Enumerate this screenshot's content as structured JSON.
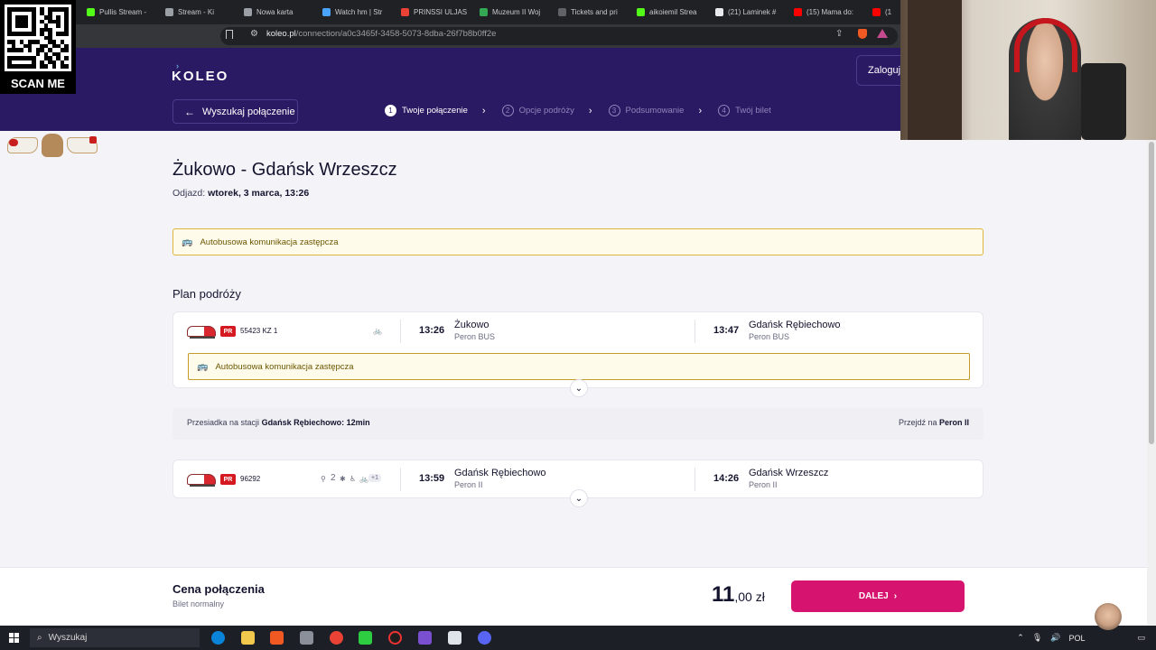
{
  "browser": {
    "tabs": [
      {
        "label": "Pullis Stream - ",
        "color": "#53fc18"
      },
      {
        "label": "Stream - Ki",
        "color": "#9aa0a6"
      },
      {
        "label": "Nowa karta",
        "color": "#9aa0a6"
      },
      {
        "label": "Watch hm | Str",
        "color": "#4aa3ff"
      },
      {
        "label": "PRINSSI ULJAS",
        "color": "#ea4335"
      },
      {
        "label": "Muzeum II Woj",
        "color": "#34a853"
      },
      {
        "label": "Tickets and pri",
        "color": "#5f6368"
      },
      {
        "label": "aikoiemil Strea",
        "color": "#53fc18"
      },
      {
        "label": "(21) Laminek #",
        "color": "#e8eaed"
      },
      {
        "label": "(15) Mama do:",
        "color": "#ff0000"
      },
      {
        "label": "(1",
        "color": "#ff0000"
      }
    ],
    "url_host": "koleo.pl",
    "url_path": "/connection/a0c3465f-3458-5073-8dba-26f7b8b0ff2e"
  },
  "overlay": {
    "qr_label": "SCAN ME"
  },
  "header": {
    "logo": "KOLEO",
    "login_label": "Zaloguj",
    "back_label": "Wyszukaj połączenie",
    "steps": [
      {
        "num": "1",
        "label": "Twoje połączenie",
        "active": true
      },
      {
        "num": "2",
        "label": "Opcje podróży",
        "active": false
      },
      {
        "num": "3",
        "label": "Podsumowanie",
        "active": false
      },
      {
        "num": "4",
        "label": "Twój bilet",
        "active": false
      }
    ]
  },
  "main": {
    "route_title": "Żukowo - Gdańsk Wrzeszcz",
    "departure_label": "Odjazd:",
    "departure_value": "wtorek, 3 marca, 13:26",
    "notice": "Autobusowa komunikacja zastępcza",
    "plan_title": "Plan podróży",
    "legs": [
      {
        "carrier": "PR",
        "train_number": "55423 KZ 1",
        "amenities": [
          "bike-icon"
        ],
        "dep_time": "13:26",
        "dep_station": "Żukowo",
        "dep_platform": "Peron BUS",
        "arr_time": "13:47",
        "arr_station": "Gdańsk Rębiechowo",
        "arr_platform": "Peron BUS",
        "notice": "Autobusowa komunikacja zastępcza"
      },
      {
        "carrier": "PR",
        "train_number": "96292",
        "amenities": [
          "seat-icon",
          "second-class",
          "snowflake-icon",
          "wheelchair-icon",
          "bike-icon"
        ],
        "second_class": "2",
        "amenity_more": "+1",
        "dep_time": "13:59",
        "dep_station": "Gdańsk Rębiechowo",
        "dep_platform": "Peron II",
        "arr_time": "14:26",
        "arr_station": "Gdańsk Wrzeszcz",
        "arr_platform": "Peron II"
      }
    ],
    "transfer": {
      "prefix": "Przesiadka na stacji",
      "station": "Gdańsk Rębiechowo",
      "duration": ": 12min",
      "right_prefix": "Przejdź na",
      "right_platform": "Peron II"
    }
  },
  "footer": {
    "price_label": "Cena połączenia",
    "ticket_type": "Bilet normalny",
    "price_int": "11",
    "price_rest": ",00 zł",
    "next_label": "DALEJ"
  },
  "taskbar": {
    "search_placeholder": "Wyszukaj",
    "lang": "POL"
  },
  "colors": {
    "header_bg": "#2a1a63",
    "accent": "#d6136e",
    "notice_border": "#e0b53f",
    "carrier_red": "#d41920"
  }
}
